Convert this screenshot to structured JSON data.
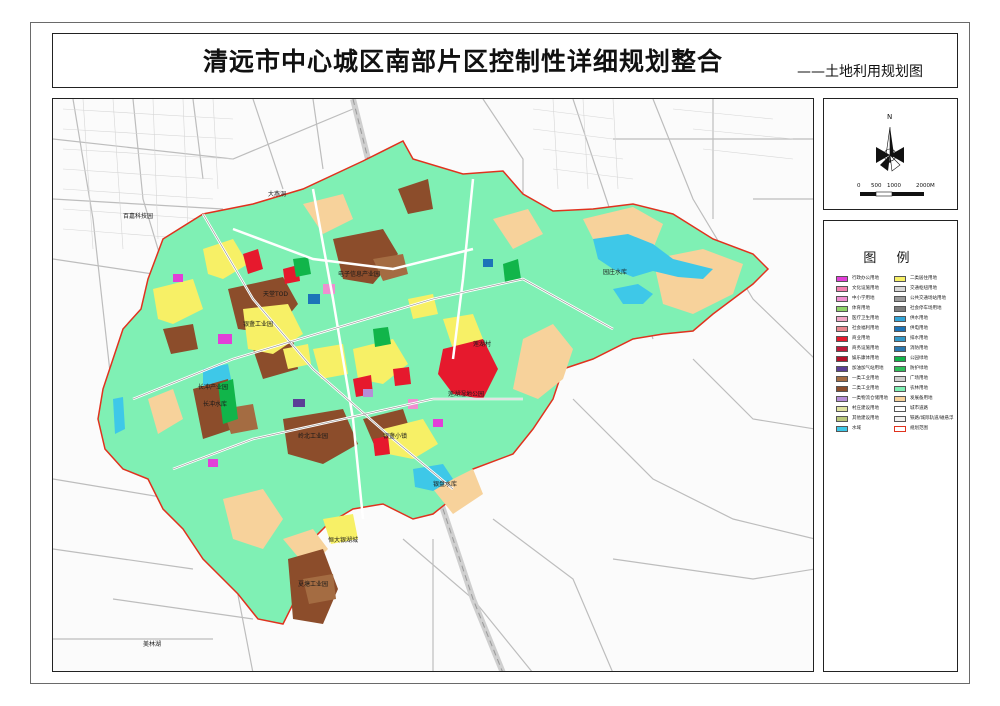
{
  "title": "清远市中心城区南部片区控制性详细规划整合",
  "subtitle": "——土地利用规划图",
  "legend_title": "图 例",
  "scale_labels": [
    "0",
    "500",
    "1000",
    "2000M"
  ],
  "north_label": "N",
  "legend": [
    {
      "code": "A1",
      "label": "行政办公用地",
      "color": "#e23fd8"
    },
    {
      "code": "R2",
      "label": "二类居住用地",
      "color": "#f7f066"
    },
    {
      "code": "A2",
      "label": "文化设施用地",
      "color": "#f27fb0"
    },
    {
      "code": "S1",
      "label": "交通枢纽用地",
      "color": "#d6d6d6"
    },
    {
      "code": "A33",
      "label": "中小学用地",
      "color": "#ee8fd0"
    },
    {
      "code": "S3",
      "label": "公共交通场站用地",
      "color": "#9a9a9a"
    },
    {
      "code": "A4",
      "label": "体育用地",
      "color": "#8fd46a"
    },
    {
      "code": "S42",
      "label": "社会停车场用地",
      "color": "#7e7e7e"
    },
    {
      "code": "A5",
      "label": "医疗卫生用地",
      "color": "#f0a6c6"
    },
    {
      "code": "U11",
      "label": "供水用地",
      "color": "#33a5d8"
    },
    {
      "code": "A6",
      "label": "社会福利用地",
      "color": "#e8868e"
    },
    {
      "code": "U12",
      "label": "供电用地",
      "color": "#1c74b8"
    },
    {
      "code": "B1",
      "label": "商业用地",
      "color": "#e6192d"
    },
    {
      "code": "U21",
      "label": "排水用地",
      "color": "#3399c9"
    },
    {
      "code": "B2",
      "label": "商务设施用地",
      "color": "#c01a3a"
    },
    {
      "code": "U31",
      "label": "消防用地",
      "color": "#2a78b0"
    },
    {
      "code": "B3",
      "label": "娱乐康体用地",
      "color": "#b5112a"
    },
    {
      "code": "G1",
      "label": "公园绿地",
      "color": "#11b54a"
    },
    {
      "code": "B41",
      "label": "加油加气站用地",
      "color": "#5b3f96"
    },
    {
      "code": "G2",
      "label": "防护绿地",
      "color": "#2fbf5a"
    },
    {
      "code": "M1",
      "label": "一类工业用地",
      "color": "#a46c42"
    },
    {
      "code": "G3",
      "label": "广场用地",
      "color": "#cfcfcf"
    },
    {
      "code": "M2",
      "label": "二类工业用地",
      "color": "#8c4d2b"
    },
    {
      "code": "E2",
      "label": "农林用地",
      "color": "#7ff0b4"
    },
    {
      "code": "W1",
      "label": "一类物流仓储用地",
      "color": "#b68ed8"
    },
    {
      "code": "",
      "label": "发展备用地",
      "color": "#f7d29b"
    },
    {
      "code": "H14",
      "label": "村庄建设用地",
      "color": "#dfe2a0"
    },
    {
      "code": "",
      "label": "城市道路",
      "color": "#ffffff"
    },
    {
      "code": "H9",
      "label": "其他建设用地",
      "color": "#b9c77a"
    },
    {
      "code": "",
      "label": "铁路/城际轨道/磁悬浮",
      "color": "#f2f2f2"
    },
    {
      "code": "E1",
      "label": "水域",
      "color": "#3ec8e8"
    },
    {
      "code": "",
      "label": "规划范围",
      "color": "#ffffff"
    }
  ],
  "map_labels": {
    "dayan": "大燕洞",
    "baijia": "百嘉科技园",
    "dianzi": "电子信息产业园",
    "yinsheng": "银盏工业园",
    "shangchang": "长冲产业园",
    "changchong": "长冲水库",
    "yuanzhuang": "园庄水库",
    "lianhe": "莲湖村",
    "lianhu_park": "莲湖湿地公园",
    "liuxi": "岭北工业园",
    "yindang": "银盏小镇",
    "yinpan": "银盘水库",
    "hengda": "恒大银湖城",
    "xiatang": "夏塘工业园",
    "meilin": "美林湖",
    "tiantang": "天堂TOD"
  },
  "colors": {
    "base_green": "#7ff0b4",
    "reserve": "#f7d29b",
    "water": "#3ec8e8",
    "industry": "#8c4d2b",
    "residential": "#f7f066",
    "commercial": "#e6192d",
    "boundary": "#e0321e"
  }
}
